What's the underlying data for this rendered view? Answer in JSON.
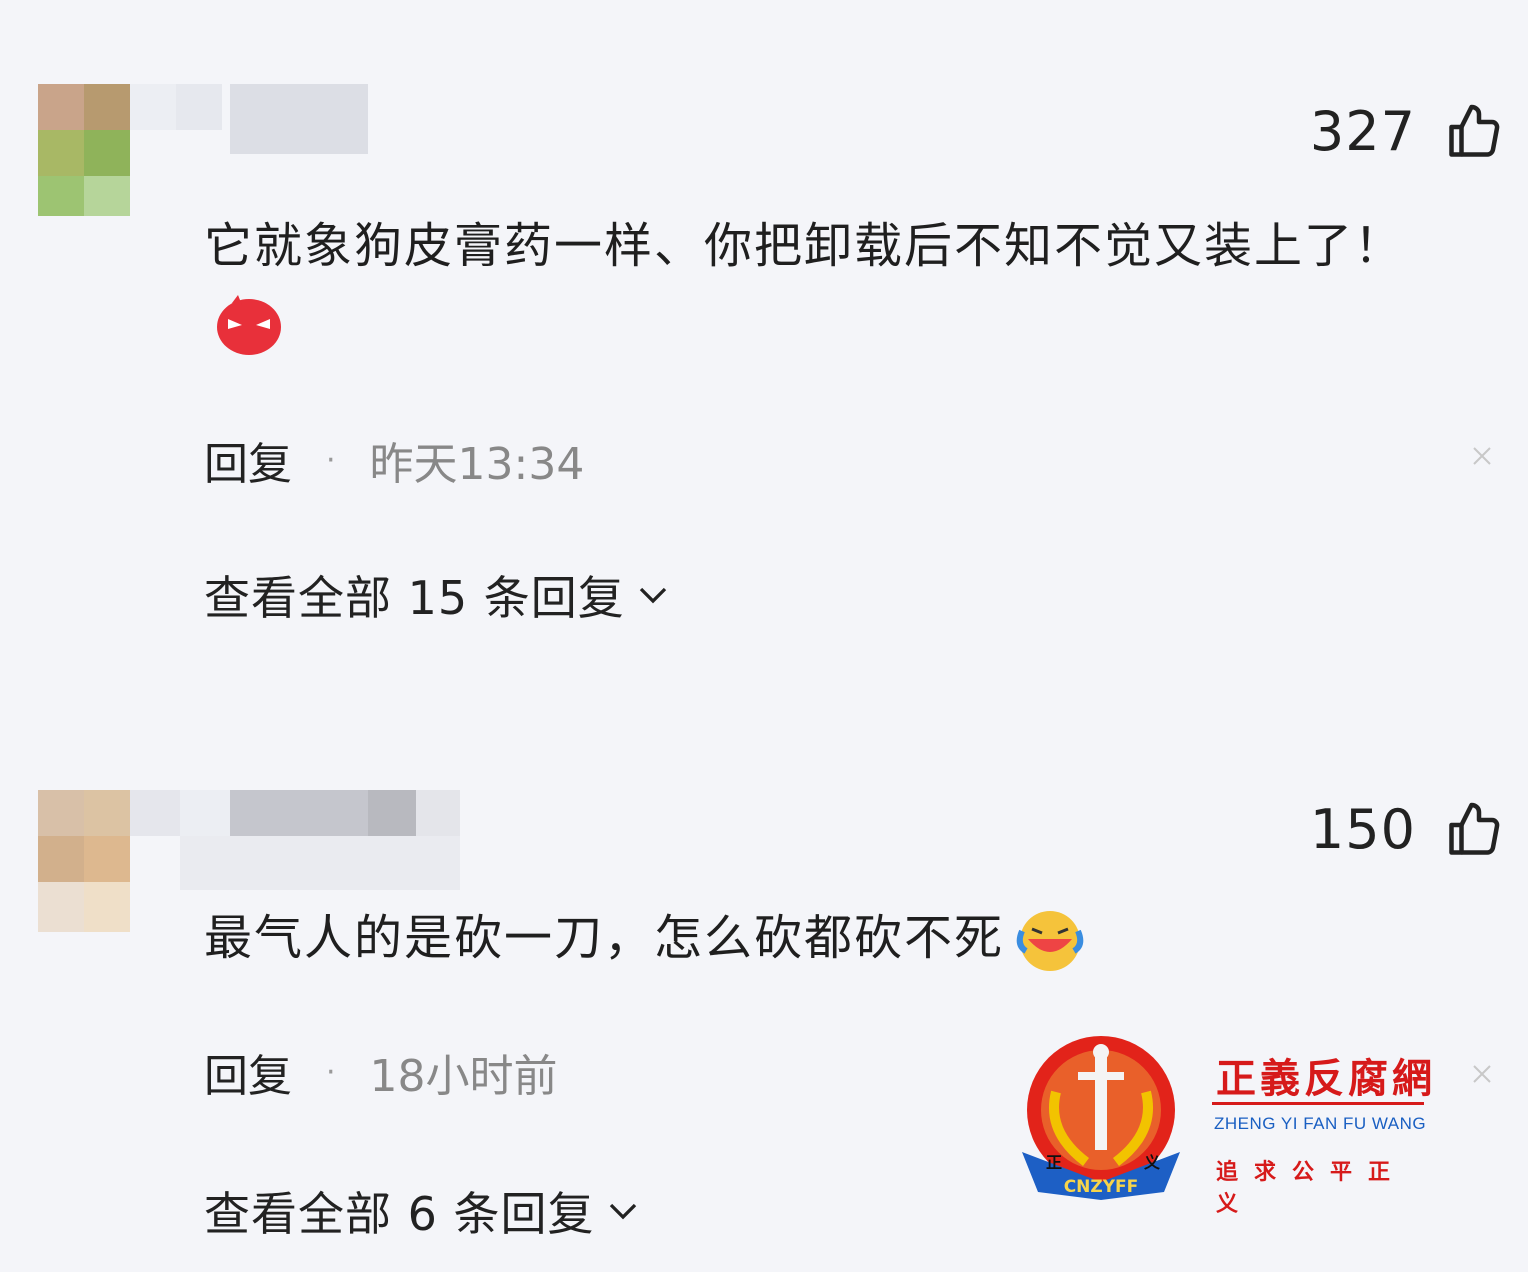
{
  "comments": [
    {
      "likes": "327",
      "text": "它就象狗皮膏药一样、你把卸载后不知不觉又装上了！",
      "reply_label": "回复",
      "separator": "·",
      "time": "昨天13:34",
      "view_all": "查看全部 15 条回复"
    },
    {
      "likes": "150",
      "text": "最气人的是砍一刀，怎么砍都砍不死",
      "reply_label": "回复",
      "separator": "·",
      "time": "18小时前",
      "view_all": "查看全部 6 条回复"
    }
  ],
  "watermark": {
    "title": "正義反腐網",
    "subtitle": "ZHENG YI FAN FU WANG",
    "slogan": "追求公平正义",
    "seal_text": "CNZYFF",
    "seal_chars": [
      "正",
      "义"
    ]
  },
  "icons": {
    "like": "thumbs-up-icon",
    "close": "close-icon",
    "expand": "chevron-down-icon",
    "emoji1": "devil-face-emoji",
    "emoji2": "laughing-crying-emoji"
  }
}
